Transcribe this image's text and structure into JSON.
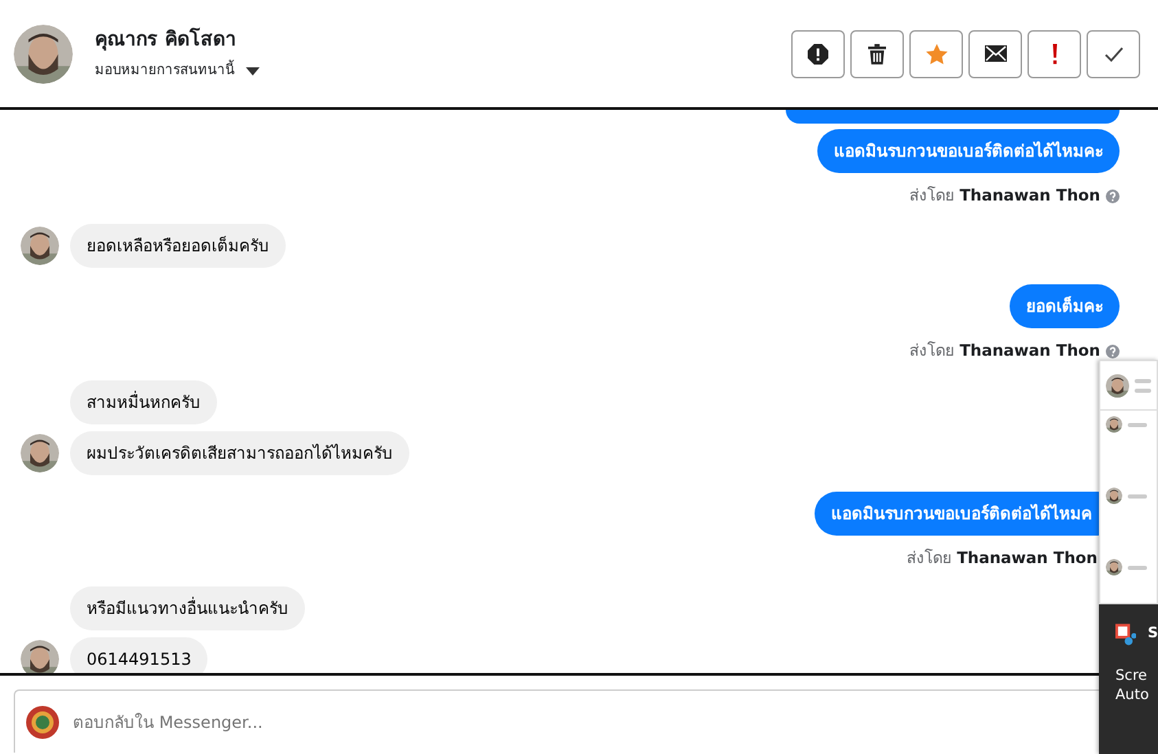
{
  "header": {
    "name": "คุณากร คิดโสดา",
    "assign_label": "มอบหมายการสนทนานี้",
    "actions": [
      {
        "kind": "alert"
      },
      {
        "kind": "delete"
      },
      {
        "kind": "star"
      },
      {
        "kind": "mail"
      },
      {
        "kind": "exclaim"
      },
      {
        "kind": "done"
      }
    ]
  },
  "messages": [
    {
      "kind": "sent-cut"
    },
    {
      "kind": "sent",
      "text": "แอดมินรบกวนขอเบอร์ติดต่อได้ไหมคะ",
      "sent_by_label": "ส่งโดย",
      "sender": "Thanawan Thon",
      "info_icon": true,
      "covered": false
    },
    {
      "kind": "received",
      "text": "ยอดเหลือหรือยอดเต็มครับ",
      "avatar": true
    },
    {
      "kind": "sent",
      "text": "ยอดเต็มคะ",
      "sent_by_label": "ส่งโดย",
      "sender": "Thanawan Thon",
      "info_icon": true,
      "covered": false
    },
    {
      "kind": "received",
      "text": "สามหมื่นหกครับ",
      "avatar": false
    },
    {
      "kind": "received",
      "text": "ผมประวัตเครดิตเสียสามารถออกได้ไหมครับ",
      "avatar": true
    },
    {
      "kind": "sent",
      "text": "แอดมินรบกวนขอเบอร์ติดต่อได้ไหมค",
      "sent_by_label": "ส่งโดย",
      "sender": "Thanawan Thon",
      "covered": true
    },
    {
      "kind": "received",
      "text": "หรือมีแนวทางอื่นแนะนำครับ",
      "avatar": false
    },
    {
      "kind": "received",
      "text": "0614491513",
      "avatar": true
    }
  ],
  "composer": {
    "placeholder": "ตอบกลับใน Messenger..."
  },
  "toast": {
    "title": "S",
    "lines": [
      "Scre",
      "Auto"
    ]
  }
}
